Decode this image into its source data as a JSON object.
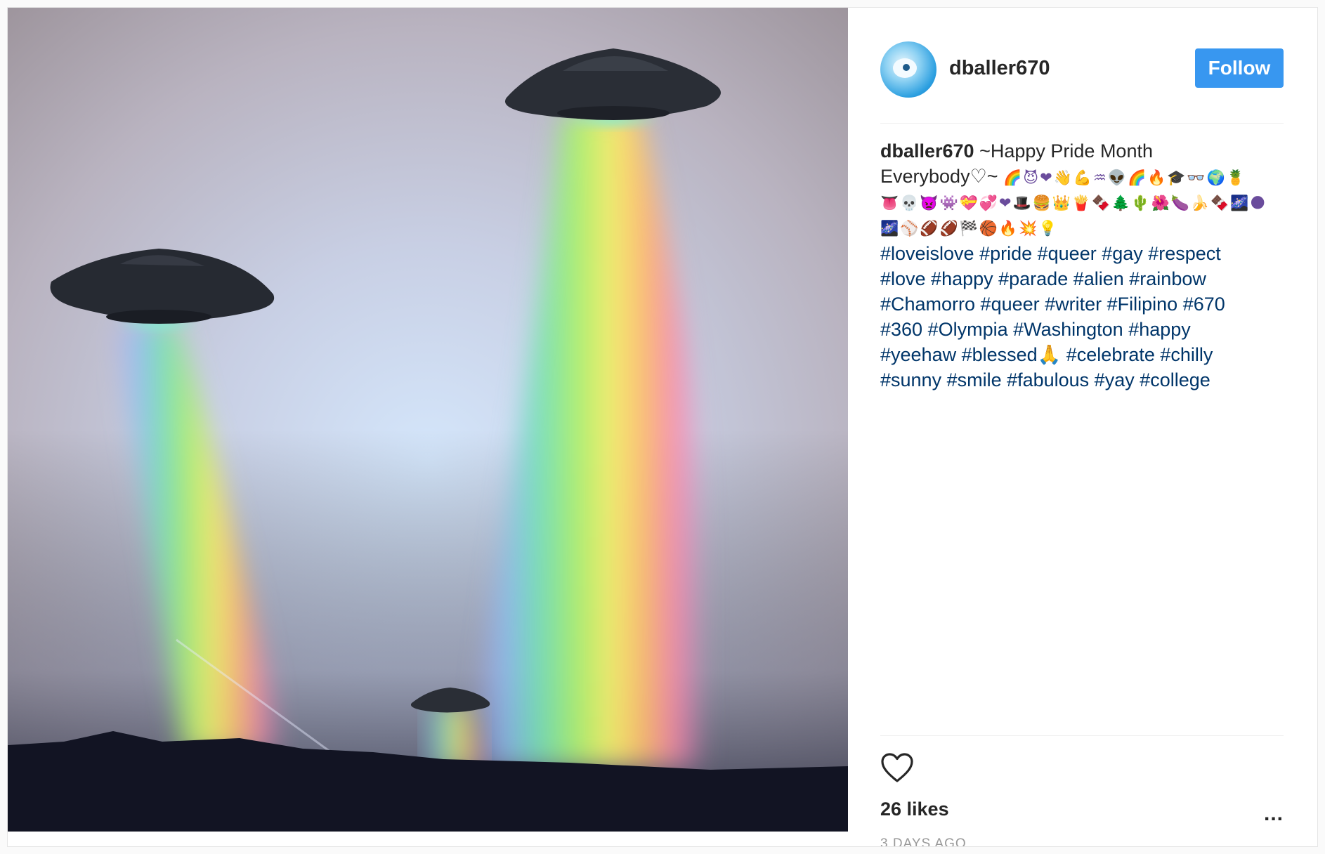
{
  "post": {
    "username": "dballer670",
    "follow_label": "Follow",
    "caption": {
      "username": "dballer670",
      "line1": "~Happy Pride Month",
      "line2": "Everybody♡~",
      "emoji_line1": "🌈😈❤👋💪♒👽🌈🔥🎓👓🌍🍍",
      "emoji_line2": "👅💀👿👾💝💞❤🎩🍔👑🍟🍫🌲🌵🌺🍆🍌🍫🌌🌑",
      "emoji_line3": "🌌⚾🏈🏈🏁🏀🔥💥💡",
      "hashtag_lines": [
        "#loveislove #pride #queer #gay #respect",
        "#love #happy #parade #alien #rainbow",
        "#Chamorro #queer #writer #Filipino #670",
        "#360 #Olympia #Washington #happy",
        "#yeehaw #blessed🙏 #celebrate #chilly",
        "#sunny #smile #fabulous #yay #college"
      ]
    },
    "likes": "26 likes",
    "time": "3 DAYS AGO",
    "more_label": "...",
    "icons": {
      "heart": "heart-outline-icon",
      "more": "more-options-icon"
    },
    "colors": {
      "follow_button": "#3897f0",
      "hashtag": "#003569",
      "text": "#262626",
      "muted": "#999999"
    }
  }
}
